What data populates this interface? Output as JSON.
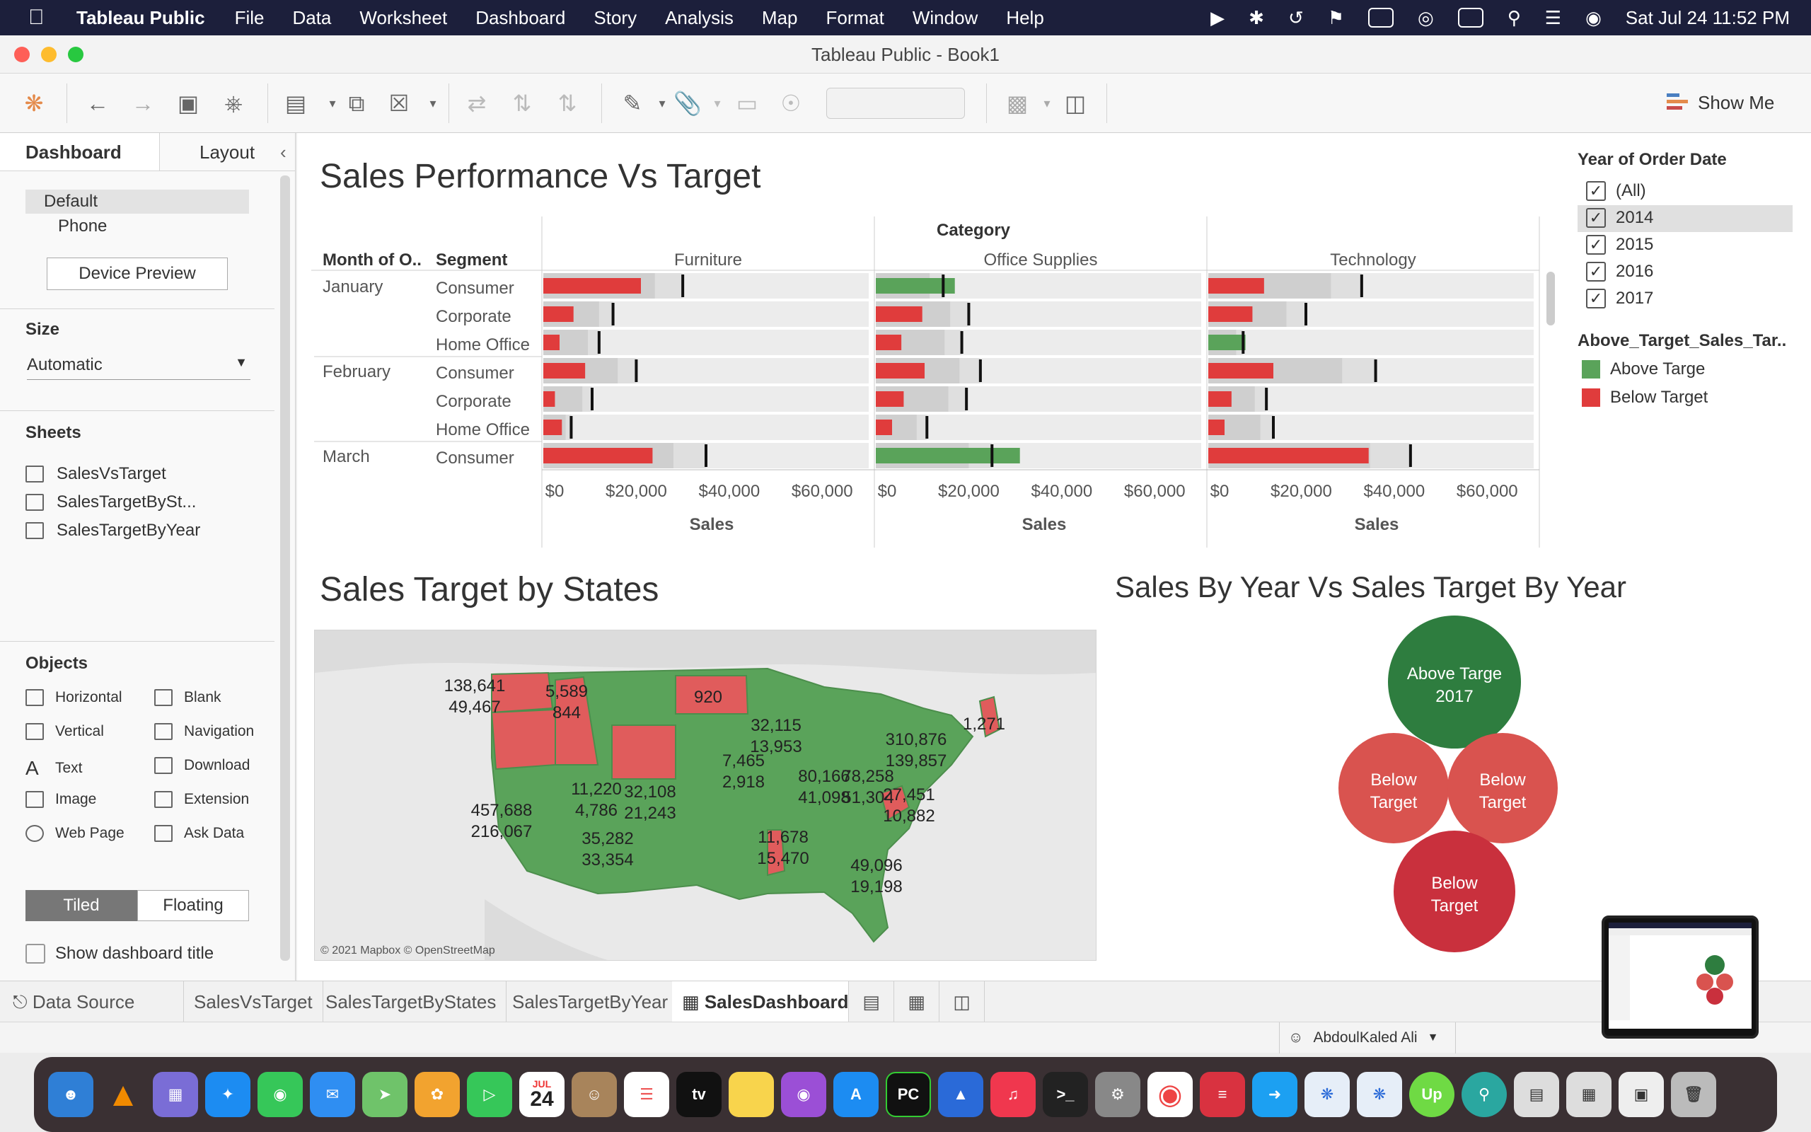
{
  "menubar": {
    "app_name": "Tableau Public",
    "items": [
      "File",
      "Data",
      "Worksheet",
      "Dashboard",
      "Story",
      "Analysis",
      "Map",
      "Format",
      "Window",
      "Help"
    ],
    "clock": "Sat Jul 24  11:52 PM"
  },
  "window": {
    "title": "Tableau Public - Book1"
  },
  "toolbar": {
    "show_me_label": "Show Me"
  },
  "side_panel": {
    "tabs": [
      "Dashboard",
      "Layout"
    ],
    "device_options": [
      "Default",
      "Phone"
    ],
    "device_preview_label": "Device Preview",
    "size_heading": "Size",
    "size_value": "Automatic",
    "sheets_heading": "Sheets",
    "sheets": [
      "SalesVsTarget",
      "SalesTargetBySt...",
      "SalesTargetByYear"
    ],
    "objects_heading": "Objects",
    "objects": [
      "Horizontal",
      "Blank",
      "Vertical",
      "Navigation",
      "Text",
      "Download",
      "Image",
      "Extension",
      "Web Page",
      "Ask Data"
    ],
    "layout_modes": [
      "Tiled",
      "Floating"
    ],
    "show_title_label": "Show dashboard title"
  },
  "dashboard": {
    "title_1": "Sales Performance Vs Target",
    "title_2": "Sales Target by States",
    "title_3": "Sales By Year Vs Sales Target By Year",
    "map_credit": "© 2021 Mapbox © OpenStreetMap",
    "colors": {
      "above": "#5aa35a",
      "below": "#e03c3c",
      "band_dark": "#cfcfcf",
      "band_mid": "#dfdfdf",
      "band_light": "#ececec"
    }
  },
  "chart_data": [
    {
      "type": "bar",
      "subtype": "bullet",
      "title": "Sales Performance Vs Target",
      "column_header": "Category",
      "row_headers": [
        "Month of O..",
        "Segment"
      ],
      "categories": [
        "Furniture",
        "Office Supplies",
        "Technology"
      ],
      "rows": [
        {
          "month": "January",
          "segment": "Consumer"
        },
        {
          "month": "",
          "segment": "Corporate"
        },
        {
          "month": "",
          "segment": "Home Office"
        },
        {
          "month": "February",
          "segment": "Consumer"
        },
        {
          "month": "",
          "segment": "Corporate"
        },
        {
          "month": "",
          "segment": "Home Office"
        },
        {
          "month": "March",
          "segment": "Consumer"
        }
      ],
      "xlabel": "Sales",
      "x_ticks": [
        "$0",
        "$20,000",
        "$40,000",
        "$60,000"
      ],
      "xlim": [
        0,
        70000
      ],
      "series": [
        {
          "name": "Furniture",
          "sales": [
            21000,
            6500,
            3500,
            9000,
            2500,
            4000,
            23500
          ],
          "target": [
            30000,
            15000,
            12000,
            20000,
            10500,
            6000,
            35000
          ],
          "above": [
            false,
            false,
            false,
            false,
            false,
            false,
            false
          ]
        },
        {
          "name": "Office Supplies",
          "sales": [
            17000,
            10000,
            5500,
            10500,
            6000,
            3500,
            31000
          ],
          "target": [
            14500,
            20000,
            18500,
            22500,
            19500,
            11000,
            25000
          ],
          "above": [
            true,
            false,
            false,
            false,
            false,
            false,
            true
          ]
        },
        {
          "name": "Technology",
          "sales": [
            12000,
            9500,
            8000,
            14000,
            5000,
            3500,
            34500
          ],
          "target": [
            33000,
            21000,
            7500,
            36000,
            12500,
            14000,
            43500
          ],
          "above": [
            false,
            false,
            true,
            false,
            false,
            false,
            false
          ]
        }
      ]
    },
    {
      "type": "map",
      "title": "Sales Target by States",
      "labels": [
        {
          "a": "138,641",
          "b": "49,467"
        },
        {
          "a": "5,589",
          "b": "844"
        },
        {
          "a": "920",
          "b": ""
        },
        {
          "a": "32,115",
          "b": "13,953"
        },
        {
          "a": "1,271",
          "b": ""
        },
        {
          "a": "310,876",
          "b": "139,857"
        },
        {
          "a": "7,465",
          "b": "2,918"
        },
        {
          "a": "80,166",
          "b": "41,098"
        },
        {
          "a": "78,258",
          "b": "51,304"
        },
        {
          "a": "27,451",
          "b": "10,882"
        },
        {
          "a": "11,220",
          "b": "4,786"
        },
        {
          "a": "32,108",
          "b": "21,243"
        },
        {
          "a": "457,688",
          "b": "216,067"
        },
        {
          "a": "35,282",
          "b": "33,354"
        },
        {
          "a": "11,678",
          "b": "15,470"
        },
        {
          "a": "49,096",
          "b": "19,198"
        }
      ]
    },
    {
      "type": "bubble",
      "title": "Sales By Year Vs Sales Target By Year",
      "bubbles": [
        {
          "label": "Above Targe",
          "sublabel": "2017",
          "status": "above"
        },
        {
          "label": "Below",
          "sublabel": "Target",
          "status": "below"
        },
        {
          "label": "Below",
          "sublabel": "Target",
          "status": "below"
        },
        {
          "label": "Below",
          "sublabel": "Target",
          "status": "below-dark"
        }
      ]
    }
  ],
  "filter": {
    "title": "Year of Order Date",
    "options": [
      "(All)",
      "2014",
      "2015",
      "2016",
      "2017"
    ],
    "checked": [
      true,
      true,
      true,
      true,
      true
    ]
  },
  "legend": {
    "title": "Above_Target_Sales_Tar..",
    "items": [
      {
        "label": "Above Targe",
        "color": "#5aa35a"
      },
      {
        "label": "Below Target",
        "color": "#e03c3c"
      }
    ]
  },
  "tabs": {
    "data_source": "Data Source",
    "sheets": [
      "SalesVsTarget",
      "SalesTargetByStates",
      "SalesTargetByYear",
      "SalesDashboard"
    ]
  },
  "status": {
    "user": "AbdoulKaled Ali"
  },
  "dock": {
    "calendar_month": "JUL",
    "calendar_day": "24",
    "tv_label": "tv",
    "pycharm_label": "PC",
    "upwork_label": "Up"
  }
}
